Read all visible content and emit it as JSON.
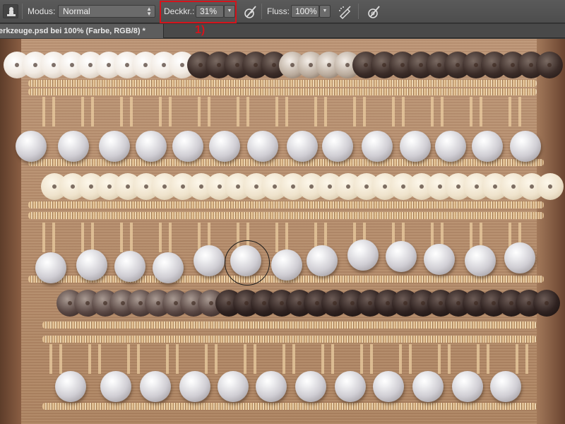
{
  "options_bar": {
    "tool_preset_icon": "stamp-tool-icon",
    "mode_label": "Modus:",
    "mode_value": "Normal",
    "opacity_label": "Deckkr.:",
    "opacity_value": "31%",
    "pressure_opacity_icon": "pen-pressure-opacity-icon",
    "flow_label": "Fluss:",
    "flow_value": "100%",
    "airbrush_icon": "airbrush-icon",
    "pressure_size_icon": "pen-pressure-size-icon"
  },
  "annotation": {
    "marker": "1)",
    "color": "#d4141c"
  },
  "document_tab": {
    "title": "erkzeuge.psd bei 100% (Farbe, RGB/8) *"
  }
}
